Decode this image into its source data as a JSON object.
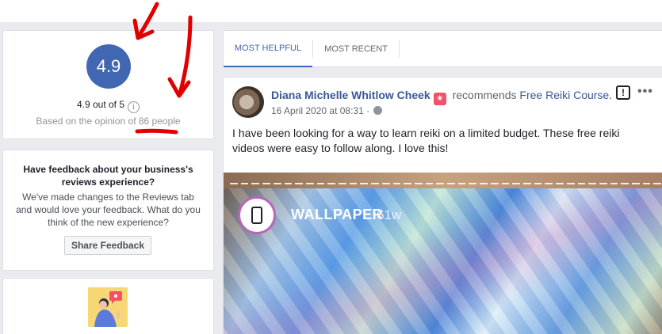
{
  "rating": {
    "score": "4.9",
    "out_of": "4.9 out of 5",
    "info_glyph": "i",
    "opinion_prefix": "Based on the opinion of ",
    "opinion_people": "86 people"
  },
  "feedback": {
    "title": "Have feedback about your business's reviews experience?",
    "body": "We've made changes to the Reviews tab and would love your feedback. What do you think of the new experience?",
    "button_label": "Share Feedback"
  },
  "tabs": [
    {
      "label": "MOST HELPFUL",
      "active": true
    },
    {
      "label": "MOST RECENT",
      "active": false
    }
  ],
  "review": {
    "author": "Diana Michelle Whitlow Cheek",
    "badge_icon": "recommend-badge-icon",
    "recommends_text": " recommends ",
    "page_name": "Free Reiki Course.",
    "date": "16 April 2020 at 08:31 · ",
    "report_glyph": "!",
    "more_glyph": "•••",
    "text": "I have been looking for a way to learn reiki on a limited budget. These free reiki videos were easy to follow along. I love this!",
    "media": {
      "account_name": "WALLPAPER",
      "time_ago": "61w"
    }
  },
  "colors": {
    "accent": "#4267b2",
    "link": "#385898",
    "annotation": "#e00000"
  }
}
